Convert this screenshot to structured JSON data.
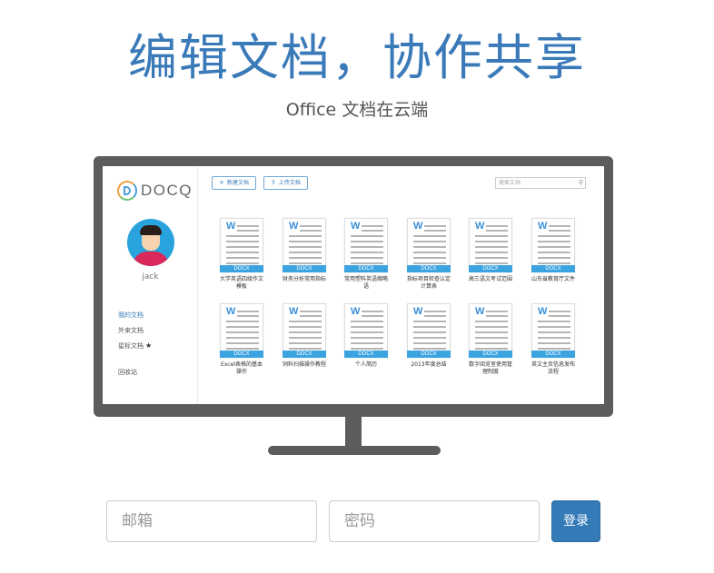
{
  "hero": {
    "title": "编辑文档，协作共享",
    "subtitle": "Office 文档在云端"
  },
  "app": {
    "logo_text": "DOCQ",
    "user": {
      "name": "jack"
    },
    "nav": {
      "my_docs": "我的文档",
      "external_docs": "外来文档",
      "starred_docs": "星标文档",
      "star_icon": "★",
      "recycle_bin": "回收站"
    },
    "toolbar": {
      "new_doc": "新建文档",
      "upload_doc": "上传文档",
      "new_icon": "+",
      "upload_icon": "⇪",
      "search_placeholder": "搜索文档",
      "search_icon": "⚲"
    },
    "doc_letter": "W",
    "doc_type": "DOCX",
    "documents": [
      [
        "大学英语四级作文",
        "模板"
      ],
      [
        "财务分析常用指标",
        ""
      ],
      [
        "常用塑料英语缩略",
        "语"
      ],
      [
        "指标项目检查认定",
        "计算表"
      ],
      [
        "高三语文考试范围",
        ""
      ],
      [
        "山东省教育厅文件",
        ""
      ],
      [
        "Excel表格的基本",
        "操作"
      ],
      [
        "饲料扫描操作教程",
        ""
      ],
      [
        "个人简历",
        ""
      ],
      [
        "2013年度总结",
        ""
      ],
      [
        "数字阅览室使用管",
        "理制度"
      ],
      [
        "英文主页信息发布",
        "流程"
      ]
    ]
  },
  "login": {
    "email_placeholder": "邮箱",
    "password_placeholder": "密码",
    "submit_label": "登录"
  },
  "colors": {
    "accent": "#3a7ab8",
    "button": "#337ab7",
    "monitor": "#5c5c5c",
    "doc_tag": "#3ba3e0"
  }
}
